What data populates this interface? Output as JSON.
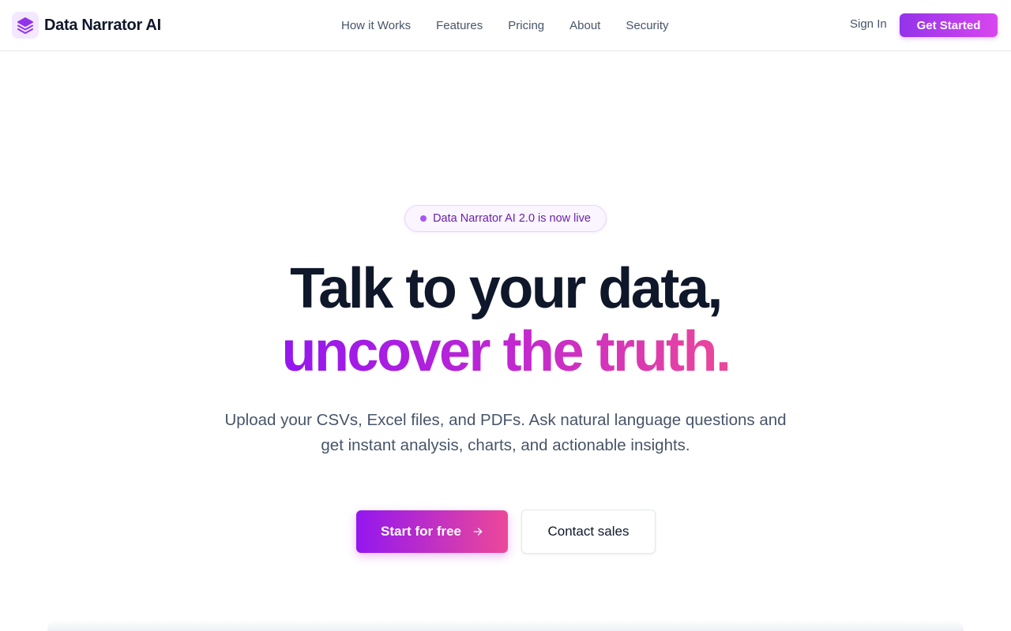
{
  "nav": {
    "brand": "Data Narrator AI",
    "brand_icon": "layers-icon",
    "links": [
      "How it Works",
      "Features",
      "Pricing",
      "About",
      "Security"
    ],
    "sign_in": "Sign In",
    "get_started": "Get Started"
  },
  "hero": {
    "badge": "Data Narrator AI 2.0 is now live",
    "title_line1": "Talk to your data,",
    "title_line2": "uncover the truth.",
    "subtitle": "Upload your CSVs, Excel files, and PDFs. Ask natural language questions and get instant analysis, charts, and actionable insights.",
    "cta_primary": "Start for free",
    "cta_primary_icon": "arrow-right-icon",
    "cta_secondary": "Contact sales"
  },
  "colors": {
    "accent_start": "#9317ef",
    "accent_mid": "#c026d3",
    "accent_end": "#ec4899",
    "text_dark": "#0f172a",
    "text_muted": "#475569"
  }
}
